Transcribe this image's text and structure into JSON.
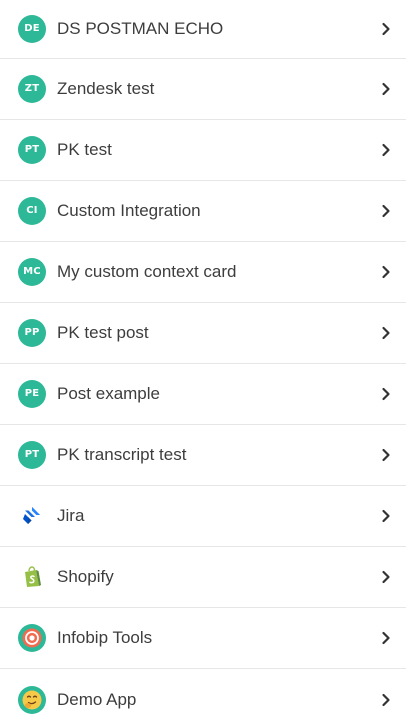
{
  "items": [
    {
      "initials": "DE",
      "label": "DS POSTMAN ECHO"
    },
    {
      "initials": "ZT",
      "label": "Zendesk test"
    },
    {
      "initials": "PT",
      "label": "PK test"
    },
    {
      "initials": "CI",
      "label": "Custom Integration"
    },
    {
      "initials": "MC",
      "label": "My custom context card"
    },
    {
      "initials": "PP",
      "label": "PK test post"
    },
    {
      "initials": "PE",
      "label": "Post example"
    },
    {
      "initials": "PT",
      "label": "PK transcript test"
    },
    {
      "icon": "jira-icon",
      "label": "Jira"
    },
    {
      "icon": "shopify-icon",
      "label": "Shopify"
    },
    {
      "icon": "infobip-icon",
      "label": "Infobip Tools"
    },
    {
      "icon": "demo-app-icon",
      "label": "Demo App"
    }
  ],
  "colors": {
    "avatar_bg": "#2db997",
    "text": "#3d3d3d",
    "divider": "#e6e6e6",
    "chevron": "#333333"
  },
  "chevron_icon": "chevron-right-icon"
}
